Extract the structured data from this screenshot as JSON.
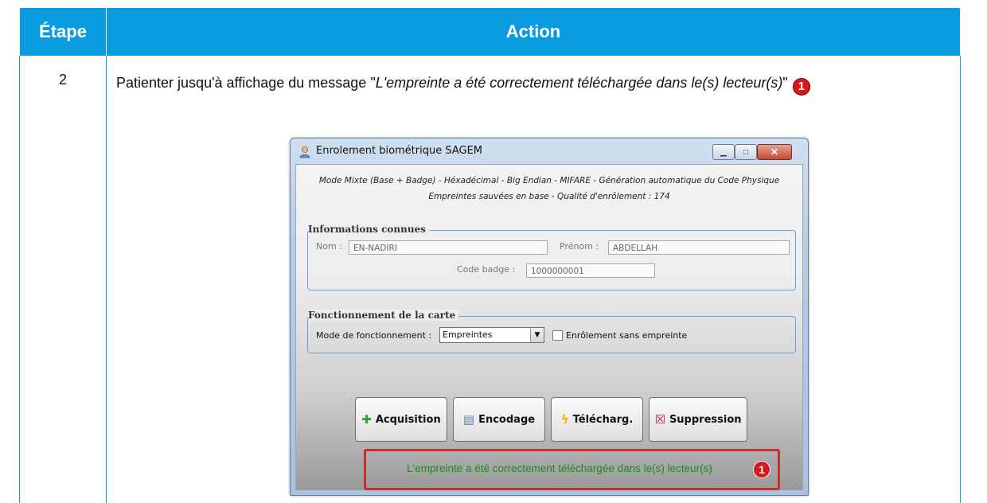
{
  "table": {
    "header_step": "Étape",
    "header_action": "Action",
    "step_number": "2",
    "instruction_prefix": "Patienter jusqu'à affichage du message \"",
    "instruction_italic": "L'empreinte a été correctement téléchargée dans le(s) lecteur(s)",
    "instruction_suffix": "\"",
    "callout": "1"
  },
  "window": {
    "title": "Enrolement biométrique SAGEM",
    "mode_line1": "Mode Mixte (Base + Badge) - Héxadécimal - Big Endian - MIFARE - Génération automatique du Code Physique",
    "mode_line2": "Empreintes sauvées en base - Qualité d'enrôlement : 174",
    "known": {
      "title": "Informations connues",
      "nom_label": "Nom :",
      "nom_value": "EN-NADIRI",
      "prenom_label": "Prénom :",
      "prenom_value": "ABDELLAH",
      "badge_label": "Code badge :",
      "badge_value": "1000000001"
    },
    "card": {
      "title": "Fonctionnement de la carte",
      "mode_label": "Mode de fonctionnement :",
      "mode_value": "Empreintes",
      "checkbox_label": "Enrôlement sans empreinte"
    },
    "buttons": {
      "acquisition": "Acquisition",
      "encodage": "Encodage",
      "telecharg": "Télécharg.",
      "suppression": "Suppression"
    },
    "message": "L'empreinte a été correctement téléchargée dans le(s) lecteur(s)",
    "message_callout": "1"
  },
  "colors": {
    "header_bg": "#0a9be0",
    "callout": "#d6191c",
    "message_text": "#1a8c1a",
    "message_border": "#d22a2a"
  }
}
